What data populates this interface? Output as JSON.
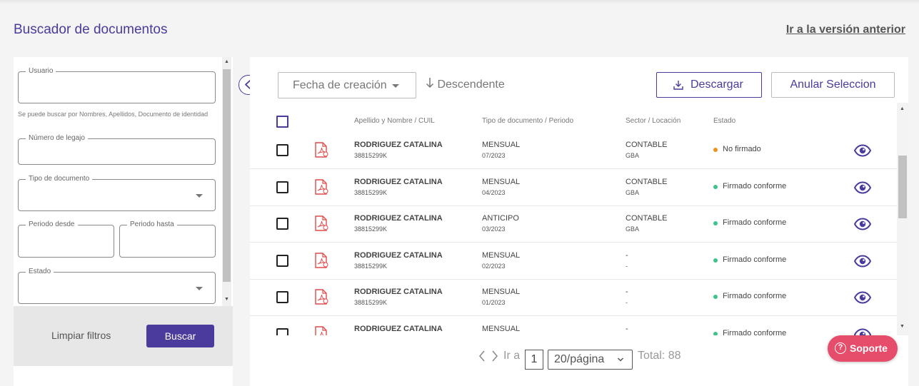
{
  "header": {
    "title": "Buscador de documentos",
    "previous_version_link": "Ir a la versión anterior"
  },
  "filters": {
    "usuario_label": "Usuario",
    "usuario_value": "",
    "usuario_hint": "Se puede buscar por Nombres, Apellidos, Documento de identidad",
    "legajo_label": "Número de legajo",
    "tipo_label": "Tipo de documento",
    "periodo_desde_label": "Periodo desde",
    "periodo_hasta_label": "Periodo hasta",
    "estado_label": "Estado",
    "clear_label": "Limpiar filtros",
    "search_label": "Buscar"
  },
  "toolbar": {
    "sort_field": "Fecha de creación",
    "sort_direction_icon": "arrow-down-icon",
    "sort_direction": "Descendente",
    "download_label": "Descargar",
    "cancel_selection_label": "Anular Seleccion"
  },
  "table": {
    "columns": [
      "Apellido y Nombre / CUIL",
      "Tipo de documento / Periodo",
      "Sector / Locación",
      "Estado"
    ],
    "rows": [
      {
        "name": "RODRIGUEZ CATALINA",
        "cuil": "38815299K",
        "type": "MENSUAL",
        "period": "07/2023",
        "sector": "CONTABLE",
        "location": "GBA",
        "state": "No firmado",
        "state_color": "#f0901d"
      },
      {
        "name": "RODRIGUEZ CATALINA",
        "cuil": "38815299K",
        "type": "MENSUAL",
        "period": "04/2023",
        "sector": "CONTABLE",
        "location": "GBA",
        "state": "Firmado conforme",
        "state_color": "#3cc48b"
      },
      {
        "name": "RODRIGUEZ CATALINA",
        "cuil": "38815299K",
        "type": "ANTICIPO",
        "period": "03/2023",
        "sector": "CONTABLE",
        "location": "GBA",
        "state": "Firmado conforme",
        "state_color": "#3cc48b"
      },
      {
        "name": "RODRIGUEZ CATALINA",
        "cuil": "38815299K",
        "type": "MENSUAL",
        "period": "02/2023",
        "sector": "-",
        "location": "-",
        "state": "Firmado conforme",
        "state_color": "#3cc48b"
      },
      {
        "name": "RODRIGUEZ CATALINA",
        "cuil": "38815299K",
        "type": "MENSUAL",
        "period": "01/2023",
        "sector": "-",
        "location": "-",
        "state": "Firmado conforme",
        "state_color": "#3cc48b"
      },
      {
        "name": "RODRIGUEZ CATALINA",
        "cuil": "",
        "type": "MENSUAL",
        "period": "",
        "sector": "-",
        "location": "",
        "state": "Firmado conforme",
        "state_color": "#3cc48b"
      }
    ]
  },
  "pagination": {
    "goto_label": "Ir a",
    "page": "1",
    "page_size": "20/página",
    "total": "Total: 88"
  },
  "support": {
    "label": "Soporte",
    "icon": "?"
  },
  "colors": {
    "brand": "#4a3b9c",
    "support": "#e64d6b",
    "pdf": "#e04a4a"
  }
}
